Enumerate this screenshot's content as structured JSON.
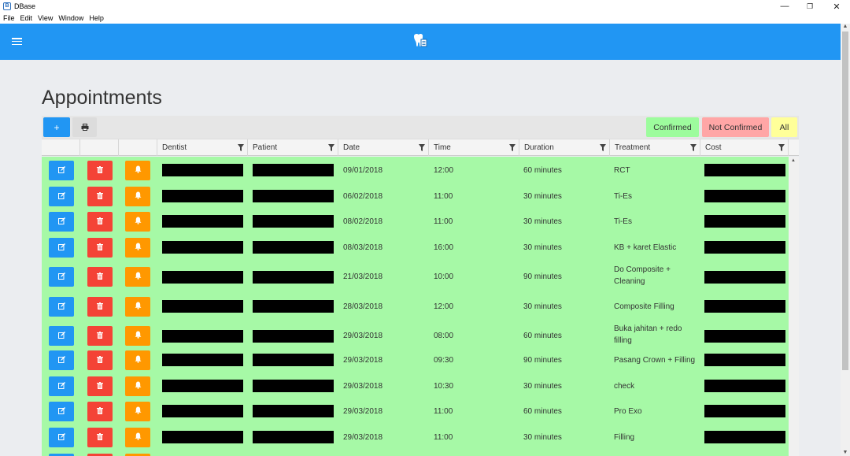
{
  "window": {
    "title": "DBase",
    "minimize": "—",
    "restore": "❐",
    "close": "✕"
  },
  "menu": [
    "File",
    "Edit",
    "View",
    "Window",
    "Help"
  ],
  "page": {
    "title": "Appointments"
  },
  "toolbar": {
    "add": "+",
    "confirmed": "Confirmed",
    "not_confirmed": "Not Confirmed",
    "all": "All"
  },
  "columns": [
    "Dentist",
    "Patient",
    "Date",
    "Time",
    "Duration",
    "Treatment",
    "Cost"
  ],
  "colors": {
    "accent": "#2196f3",
    "row_confirmed": "#a6f9a6",
    "edit": "#2196f3",
    "delete": "#f44336",
    "notify": "#ff9800"
  },
  "rows": [
    {
      "date": "09/01/2018",
      "time": "12:00",
      "duration": "60 minutes",
      "treatment": "RCT"
    },
    {
      "date": "06/02/2018",
      "time": "11:00",
      "duration": "30 minutes",
      "treatment": "Ti-Es"
    },
    {
      "date": "08/02/2018",
      "time": "11:00",
      "duration": "30 minutes",
      "treatment": "Ti-Es"
    },
    {
      "date": "08/03/2018",
      "time": "16:00",
      "duration": "30 minutes",
      "treatment": "KB + karet Elastic"
    },
    {
      "date": "21/03/2018",
      "time": "10:00",
      "duration": "90 minutes",
      "treatment": "Do Composite + Cleaning"
    },
    {
      "date": "28/03/2018",
      "time": "12:00",
      "duration": "30 minutes",
      "treatment": "Composite Filling"
    },
    {
      "date": "29/03/2018",
      "time": "08:00",
      "duration": "60 minutes",
      "treatment": "Buka jahitan + redo filling"
    },
    {
      "date": "29/03/2018",
      "time": "09:30",
      "duration": "90 minutes",
      "treatment": "Pasang Crown + Filling"
    },
    {
      "date": "29/03/2018",
      "time": "10:30",
      "duration": "30 minutes",
      "treatment": "check"
    },
    {
      "date": "29/03/2018",
      "time": "11:00",
      "duration": "60 minutes",
      "treatment": "Pro Exo"
    },
    {
      "date": "29/03/2018",
      "time": "11:00",
      "duration": "30 minutes",
      "treatment": "Filling"
    },
    {
      "date": "",
      "time": "",
      "duration": "",
      "treatment": ""
    }
  ]
}
